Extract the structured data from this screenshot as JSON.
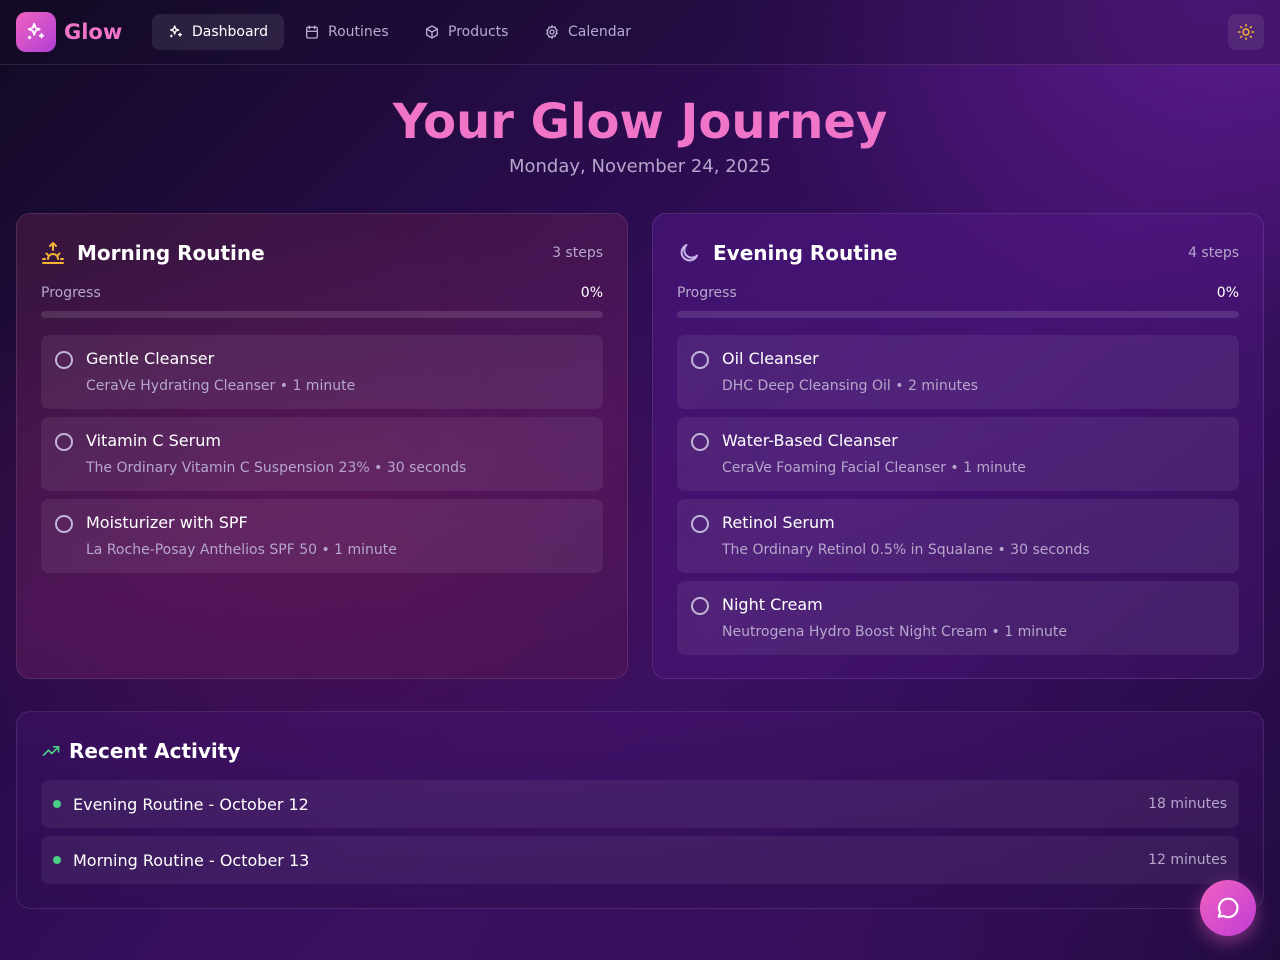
{
  "brand": {
    "name": "Glow"
  },
  "nav": {
    "items": [
      {
        "label": "Dashboard",
        "icon": "sparkles-icon",
        "active": true
      },
      {
        "label": "Routines",
        "icon": "calendar-icon",
        "active": false
      },
      {
        "label": "Products",
        "icon": "package-icon",
        "active": false
      },
      {
        "label": "Calendar",
        "icon": "gear-icon",
        "active": false
      }
    ]
  },
  "hero": {
    "title": "Your Glow Journey",
    "date": "Monday, November 24, 2025"
  },
  "routines": {
    "morning": {
      "title": "Morning Routine",
      "steps_count": "3 steps",
      "progress_label": "Progress",
      "progress_pct": "0%",
      "progress_value": 0,
      "icon": "sunrise-icon",
      "steps": [
        {
          "name": "Gentle Cleanser",
          "detail": "CeraVe Hydrating Cleanser • 1 minute"
        },
        {
          "name": "Vitamin C Serum",
          "detail": "The Ordinary Vitamin C Suspension 23% • 30 seconds"
        },
        {
          "name": "Moisturizer with SPF",
          "detail": "La Roche-Posay Anthelios SPF 50 • 1 minute"
        }
      ]
    },
    "evening": {
      "title": "Evening Routine",
      "steps_count": "4 steps",
      "progress_label": "Progress",
      "progress_pct": "0%",
      "progress_value": 0,
      "icon": "moon-icon",
      "steps": [
        {
          "name": "Oil Cleanser",
          "detail": "DHC Deep Cleansing Oil • 2 minutes"
        },
        {
          "name": "Water-Based Cleanser",
          "detail": "CeraVe Foaming Facial Cleanser • 1 minute"
        },
        {
          "name": "Retinol Serum",
          "detail": "The Ordinary Retinol 0.5% in Squalane • 30 seconds"
        },
        {
          "name": "Night Cream",
          "detail": "Neutrogena Hydro Boost Night Cream • 1 minute"
        }
      ]
    }
  },
  "activity": {
    "title": "Recent Activity",
    "icon": "trending-up-icon",
    "items": [
      {
        "label": "Evening Routine - October 12",
        "duration": "18 minutes"
      },
      {
        "label": "Morning Routine - October 13",
        "duration": "12 minutes"
      }
    ]
  },
  "colors": {
    "accent": "#f074c8",
    "sun": "#f5b335",
    "success": "#4ad084"
  }
}
